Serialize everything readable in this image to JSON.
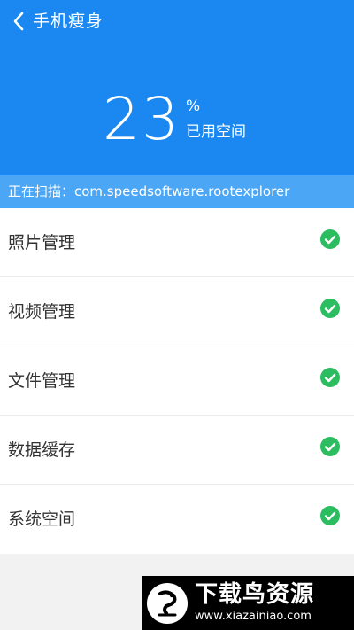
{
  "header": {
    "title": "手机瘦身",
    "back_icon": "chevron-left-icon"
  },
  "usage": {
    "percent": "23",
    "percent_sign": "%",
    "label": "已用空间"
  },
  "scan": {
    "text": "正在扫描：com.speedsoftware.rootexplorer"
  },
  "items": [
    {
      "label": "照片管理",
      "status_icon": "check-circle-icon"
    },
    {
      "label": "视频管理",
      "status_icon": "check-circle-icon"
    },
    {
      "label": "文件管理",
      "status_icon": "check-circle-icon"
    },
    {
      "label": "数据缓存",
      "status_icon": "check-circle-icon"
    },
    {
      "label": "系统空间",
      "status_icon": "check-circle-icon"
    }
  ],
  "watermark": {
    "title": "下载鸟资源",
    "url": "www.xiazainiao.com"
  },
  "colors": {
    "header_blue": "#1a88f0",
    "scan_bar_blue": "#4ba7f5",
    "check_green": "#2bbd5f",
    "page_bg": "#f2f2f2"
  }
}
